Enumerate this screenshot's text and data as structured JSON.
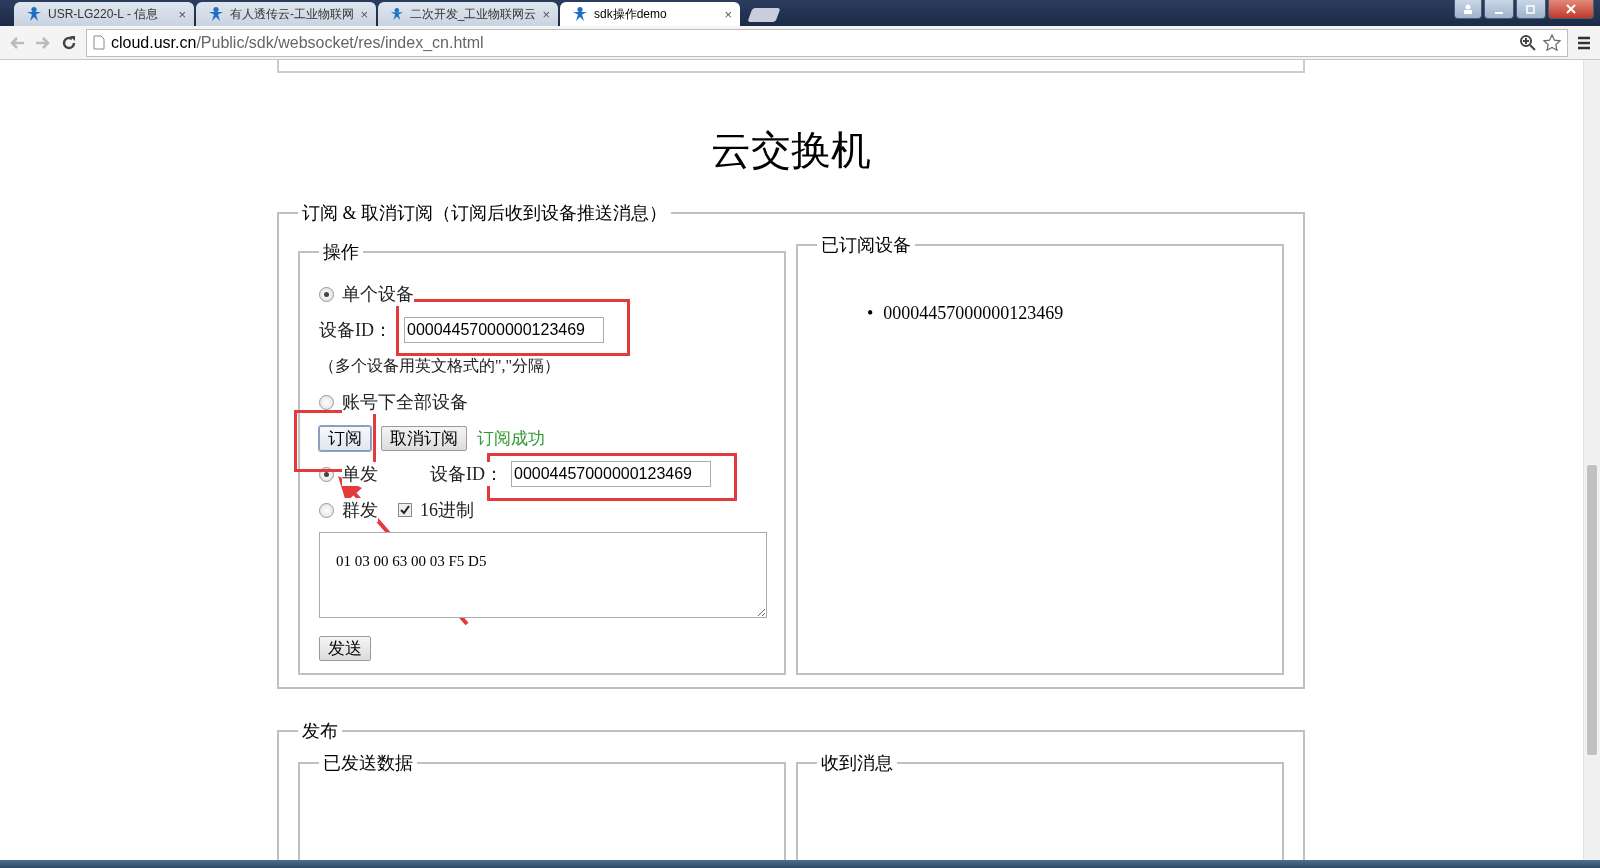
{
  "browser": {
    "tabs": [
      {
        "title": "USR-LG220-L - 信息",
        "selected": false,
        "close": "×"
      },
      {
        "title": "有人透传云-工业物联网",
        "selected": false,
        "close": "×"
      },
      {
        "title": "二次开发_工业物联网云",
        "selected": false,
        "close": "×"
      },
      {
        "title": "sdk操作demo",
        "selected": true,
        "close": "×"
      }
    ],
    "address": {
      "host": "cloud.usr.cn",
      "path": "/Public/sdk/websocket/res/index_cn.html"
    }
  },
  "page": {
    "title": "云交换机",
    "subscribe": {
      "legend": "订阅 & 取消订阅（订阅后收到设备推送消息）",
      "operation": {
        "legend": "操作",
        "scope_options": [
          {
            "label": "单个设备",
            "selected": true
          },
          {
            "label": "账号下全部设备",
            "selected": false
          }
        ],
        "device_id": {
          "label": "设备ID：",
          "value": "00004457000000123469"
        },
        "hint": "（多个设备用英文格式的\",\"分隔）",
        "buttons": [
          "订阅",
          "取消订阅"
        ],
        "status": "订阅成功",
        "send_modes": [
          {
            "label": "单发",
            "selected": true
          },
          {
            "label": "群发",
            "selected": false
          }
        ],
        "send_device_id": {
          "label": "设备ID：",
          "value": "00004457000000123469"
        },
        "hex": {
          "label": "16进制",
          "checked": true
        },
        "message": "01 03 00 63 00 03 F5 D5",
        "send_button": "发送"
      },
      "subscribed": {
        "legend": "已订阅设备",
        "bullet": "•",
        "devices": [
          "00004457000000123469"
        ]
      }
    },
    "publish": {
      "legend": "发布",
      "sent_legend": "已发送数据",
      "received_legend": "收到消息"
    }
  }
}
